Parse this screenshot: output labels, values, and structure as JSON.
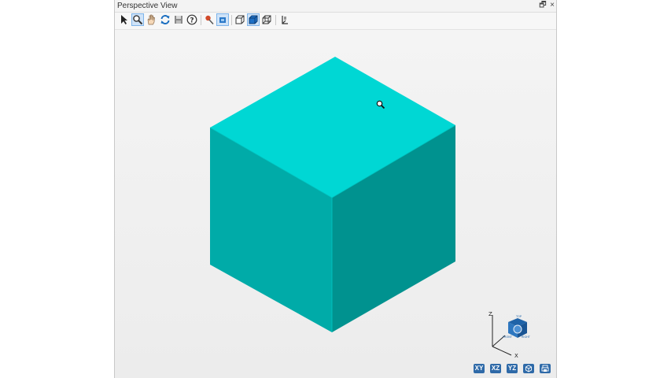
{
  "window": {
    "title": "Perspective View",
    "restore_glyph": "🗗",
    "close_glyph": "×"
  },
  "toolbar": {
    "tools": [
      {
        "name": "select-tool",
        "icon": "arrow-pointer-icon"
      },
      {
        "name": "zoom-tool",
        "icon": "magnifier-icon",
        "active": true
      },
      {
        "name": "pan-tool",
        "icon": "hand-icon"
      },
      {
        "name": "rotate-tool",
        "icon": "refresh-icon"
      },
      {
        "name": "save-tool",
        "icon": "disk-icon"
      },
      {
        "name": "help-tool",
        "icon": "help-icon"
      },
      {
        "name": "pick-tool",
        "icon": "pin-icon"
      },
      {
        "name": "display-mode-tool",
        "icon": "layer-icon"
      },
      {
        "name": "shaded-view-tool",
        "icon": "wire-cube-icon"
      },
      {
        "name": "solid-view-tool",
        "icon": "solid-cube-icon",
        "active": true
      },
      {
        "name": "wireframe-view-tool",
        "icon": "wireframe-cube-icon"
      },
      {
        "name": "axes-tool",
        "icon": "axes-icon"
      }
    ]
  },
  "viewport": {
    "model_colors": {
      "top": "#00d7d4",
      "left": "#00aba8",
      "right": "#00928f"
    },
    "triad": {
      "axis_z": "Z",
      "axis_x": "X",
      "face_top": "TOP",
      "face_front": "FRONT",
      "face_right": "RIGHT"
    },
    "view_buttons": [
      {
        "label": "XY",
        "name": "xy-view-button"
      },
      {
        "label": "XZ",
        "name": "xz-view-button"
      },
      {
        "label": "YZ",
        "name": "yz-view-button"
      },
      {
        "label": "",
        "name": "iso-view-button",
        "icon": "cube-icon"
      },
      {
        "label": "",
        "name": "print-view-button",
        "icon": "print-icon"
      }
    ]
  },
  "colors": {
    "accent": "#2f6aa8",
    "toolbar_blue": "#2a78c8"
  }
}
